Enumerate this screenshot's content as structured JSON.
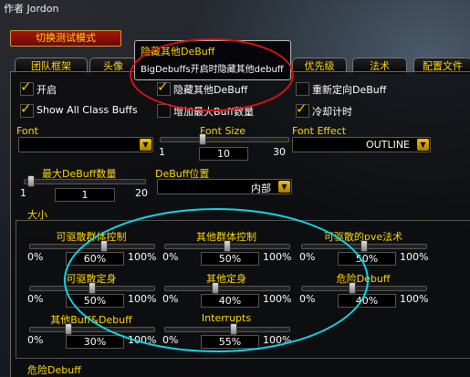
{
  "author": "作者 Jordon",
  "test_mode_button": "切换测试模式",
  "tabs": [
    "团队框架",
    "头像",
    "优先级",
    "法术",
    "配置文件"
  ],
  "tooltip": {
    "title": "隐藏其他DeBuff",
    "text": "BigDebuffs开启时隐藏其他debuff"
  },
  "options": {
    "enable": {
      "label": "开启",
      "checked": true
    },
    "hide_other": {
      "label": "隐藏其他DeBuff",
      "checked": true
    },
    "reanchor": {
      "label": "重新定向DeBuff",
      "checked": false
    },
    "show_class_buffs": {
      "label": "Show All Class Buffs",
      "checked": true
    },
    "increase_max_buffs": {
      "label": "增加最大Buff数量",
      "checked": false
    },
    "cooldown_timer": {
      "label": "冷却计时",
      "checked": true
    }
  },
  "font": {
    "label": "Font",
    "value": ""
  },
  "font_size": {
    "label": "Font Size",
    "min": "1",
    "value": "10",
    "max": "30"
  },
  "font_effect": {
    "label": "Font Effect",
    "value": "OUTLINE"
  },
  "max_debuff": {
    "label": "最大DeBuff数量",
    "min": "1",
    "value": "1",
    "max": "20"
  },
  "debuff_pos": {
    "label": "DeBuff位置",
    "value": "内部"
  },
  "size_section": "大小",
  "sliders": [
    {
      "label": "可驱散群体控制",
      "min": "0%",
      "value": "60%",
      "max": "100%"
    },
    {
      "label": "其他群体控制",
      "min": "0%",
      "value": "50%",
      "max": "100%"
    },
    {
      "label": "可驱散的pve法术",
      "min": "0%",
      "value": "50%",
      "max": "100%"
    },
    {
      "label": "可驱散定身",
      "min": "0%",
      "value": "50%",
      "max": "100%"
    },
    {
      "label": "其他定身",
      "min": "0%",
      "value": "40%",
      "max": "100%"
    },
    {
      "label": "危险Debuff",
      "min": "0%",
      "value": "40%",
      "max": "100%"
    },
    {
      "label": "其他Buff&Debuff",
      "min": "0%",
      "value": "30%",
      "max": "100%"
    },
    {
      "label": "Interrupts",
      "min": "0%",
      "value": "55%",
      "max": "100%"
    }
  ],
  "footer_section": "危险Debuff",
  "icons": {
    "dropdown": "chevron-down-icon",
    "check": "checkmark-icon"
  },
  "highlight_colors": {
    "red": "#e01010",
    "cyan": "#10d8e8"
  }
}
